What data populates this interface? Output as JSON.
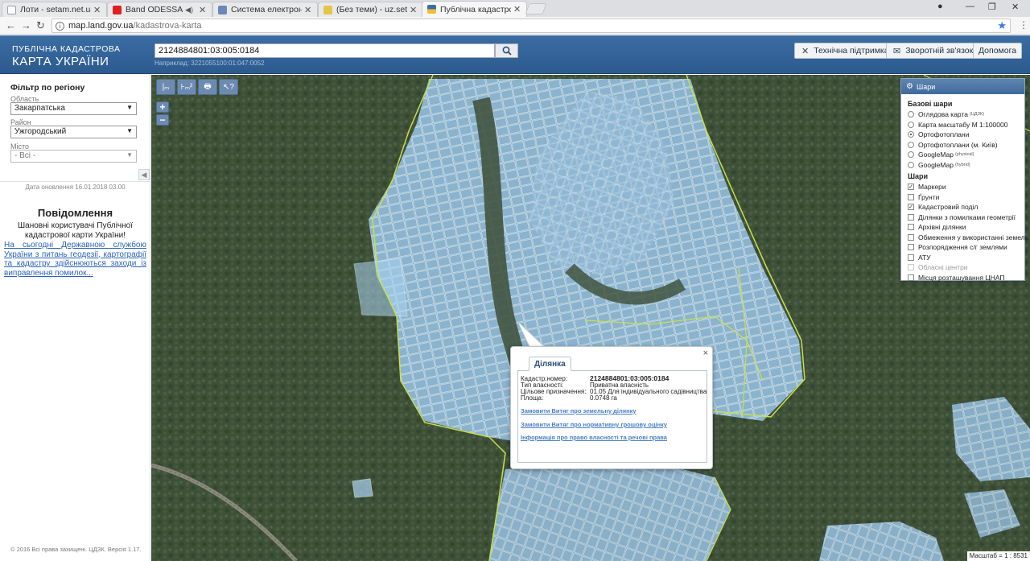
{
  "browser": {
    "tabs": [
      {
        "label": "Лоти - setam.net.ua",
        "active": false,
        "color": "#9aa0a6"
      },
      {
        "label": "Band ODESSA ХОЧУ",
        "active": false,
        "color": "#e02020",
        "audio": "◀)"
      },
      {
        "label": "Система електронної т",
        "active": false,
        "color": "#6c87b8"
      },
      {
        "label": "(Без теми) - uz.setam@",
        "active": false,
        "color": "#e7c448"
      },
      {
        "label": "Публічна кадастрова ка",
        "active": true,
        "color": "#f0c030"
      }
    ],
    "url_host": "map.land.gov.ua",
    "url_path": "/kadastrova-karta"
  },
  "header": {
    "brand_line1": "ПУБЛІЧНА КАДАСТРОВА",
    "brand_line2": "КАРТА УКРАЇНИ",
    "search_value": "2124884801:03:005:0184",
    "search_hint": "Наприклад: 3221055100:01:047:0052",
    "buttons": [
      {
        "label": "Технічна підтримка",
        "icon": "✕"
      },
      {
        "label": "Зворотній зв'язок",
        "icon": "✉"
      },
      {
        "label": "Допомога",
        "icon": ""
      }
    ]
  },
  "sidebar": {
    "filter_title": "Фільтр по регіону",
    "oblast_label": "Область",
    "oblast_value": "Закарпатська",
    "rayon_label": "Район",
    "rayon_value": "Ужгородський",
    "city_label": "Місто",
    "city_value": "- Всі -",
    "update_date": "Дата оновлення 16.01.2018 03.00",
    "news_title": "Повідомлення",
    "news_intro": "Шановні користувачі Публічної кадастрової карти України!",
    "news_link": "На сьогодні Державною службою України з питань геодезії, картографії та кадастру здійснюються заходи із виправлення помилок...",
    "footer": "© 2016 Всі права захищені. ЦДЗК. Версія 1.17."
  },
  "map": {
    "tools": [
      "|ₘ",
      "⊦ₘ²",
      "🖶",
      "↖?"
    ],
    "zoom_in": "+",
    "zoom_out": "−",
    "scale_text": "Масштаб = 1 : 8531",
    "layers_panel": {
      "title": "Шари",
      "base_title": "Базові шари",
      "base": [
        {
          "label": "Оглядова карта",
          "sup": "(ЦДЗК)",
          "checked": false
        },
        {
          "label": "Карта масштабу М 1:100000",
          "sup": "",
          "checked": false
        },
        {
          "label": "Ортофотоплани",
          "sup": "",
          "checked": true
        },
        {
          "label": "Ортофотоплани (м. Київ)",
          "sup": "",
          "checked": false
        },
        {
          "label": "GoogleMap",
          "sup": "(physical)",
          "checked": false
        },
        {
          "label": "GoogleMap",
          "sup": "(hybrid)",
          "checked": false
        }
      ],
      "overlay_title": "Шари",
      "overlays": [
        {
          "label": "Маркери",
          "checked": true,
          "disabled": false
        },
        {
          "label": "Ґрунти",
          "checked": false,
          "disabled": false
        },
        {
          "label": "Кадастровий поділ",
          "checked": true,
          "disabled": false
        },
        {
          "label": "Ділянки з помилками геометрії",
          "checked": false,
          "disabled": false
        },
        {
          "label": "Архівні ділянки",
          "checked": false,
          "disabled": false
        },
        {
          "label": "Обмеження у використанні земель",
          "checked": false,
          "disabled": false
        },
        {
          "label": "Розпорядження с/г землями",
          "checked": false,
          "disabled": false
        },
        {
          "label": "АТУ",
          "checked": false,
          "disabled": false
        },
        {
          "label": "Обласні центри",
          "checked": false,
          "disabled": true
        },
        {
          "label": "Місця розташування ЦНАП",
          "checked": false,
          "disabled": false
        }
      ]
    },
    "popup": {
      "tab_label": "Ділянка",
      "close": "×",
      "rows": [
        {
          "key": "Кадастр.номер:",
          "value": "2124884801:03:005:0184",
          "bold": true
        },
        {
          "key": "Тип власності:",
          "value": "Приватна власність",
          "bold": false
        },
        {
          "key": "Цільове призначення:",
          "value": "01.05 Для індивідуального садівництва",
          "bold": false
        },
        {
          "key": "Площа:",
          "value": "0.0748 га",
          "bold": false
        }
      ],
      "links": [
        "Замовити Витяг про земельну ділянку",
        "Замовити Витяг про нормативну грошову оцінку",
        "Інформація про право власності та речові права"
      ]
    },
    "colors": {
      "forest": "#3f5038",
      "parcel_fill": "#a9d2f0",
      "parcel_stroke": "#cfe8fb",
      "boundary": "#c8e04a"
    }
  }
}
